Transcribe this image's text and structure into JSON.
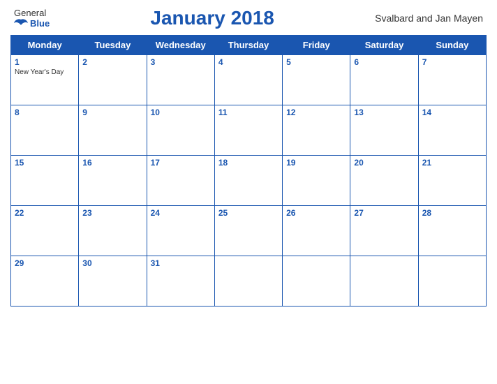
{
  "logo": {
    "general": "General",
    "blue": "Blue"
  },
  "header": {
    "title": "January 2018",
    "region": "Svalbard and Jan Mayen"
  },
  "weekdays": [
    "Monday",
    "Tuesday",
    "Wednesday",
    "Thursday",
    "Friday",
    "Saturday",
    "Sunday"
  ],
  "weeks": [
    [
      {
        "day": "1",
        "holiday": "New Year's Day"
      },
      {
        "day": "2",
        "holiday": ""
      },
      {
        "day": "3",
        "holiday": ""
      },
      {
        "day": "4",
        "holiday": ""
      },
      {
        "day": "5",
        "holiday": ""
      },
      {
        "day": "6",
        "holiday": ""
      },
      {
        "day": "7",
        "holiday": ""
      }
    ],
    [
      {
        "day": "8",
        "holiday": ""
      },
      {
        "day": "9",
        "holiday": ""
      },
      {
        "day": "10",
        "holiday": ""
      },
      {
        "day": "11",
        "holiday": ""
      },
      {
        "day": "12",
        "holiday": ""
      },
      {
        "day": "13",
        "holiday": ""
      },
      {
        "day": "14",
        "holiday": ""
      }
    ],
    [
      {
        "day": "15",
        "holiday": ""
      },
      {
        "day": "16",
        "holiday": ""
      },
      {
        "day": "17",
        "holiday": ""
      },
      {
        "day": "18",
        "holiday": ""
      },
      {
        "day": "19",
        "holiday": ""
      },
      {
        "day": "20",
        "holiday": ""
      },
      {
        "day": "21",
        "holiday": ""
      }
    ],
    [
      {
        "day": "22",
        "holiday": ""
      },
      {
        "day": "23",
        "holiday": ""
      },
      {
        "day": "24",
        "holiday": ""
      },
      {
        "day": "25",
        "holiday": ""
      },
      {
        "day": "26",
        "holiday": ""
      },
      {
        "day": "27",
        "holiday": ""
      },
      {
        "day": "28",
        "holiday": ""
      }
    ],
    [
      {
        "day": "29",
        "holiday": ""
      },
      {
        "day": "30",
        "holiday": ""
      },
      {
        "day": "31",
        "holiday": ""
      },
      {
        "day": "",
        "holiday": ""
      },
      {
        "day": "",
        "holiday": ""
      },
      {
        "day": "",
        "holiday": ""
      },
      {
        "day": "",
        "holiday": ""
      }
    ]
  ]
}
